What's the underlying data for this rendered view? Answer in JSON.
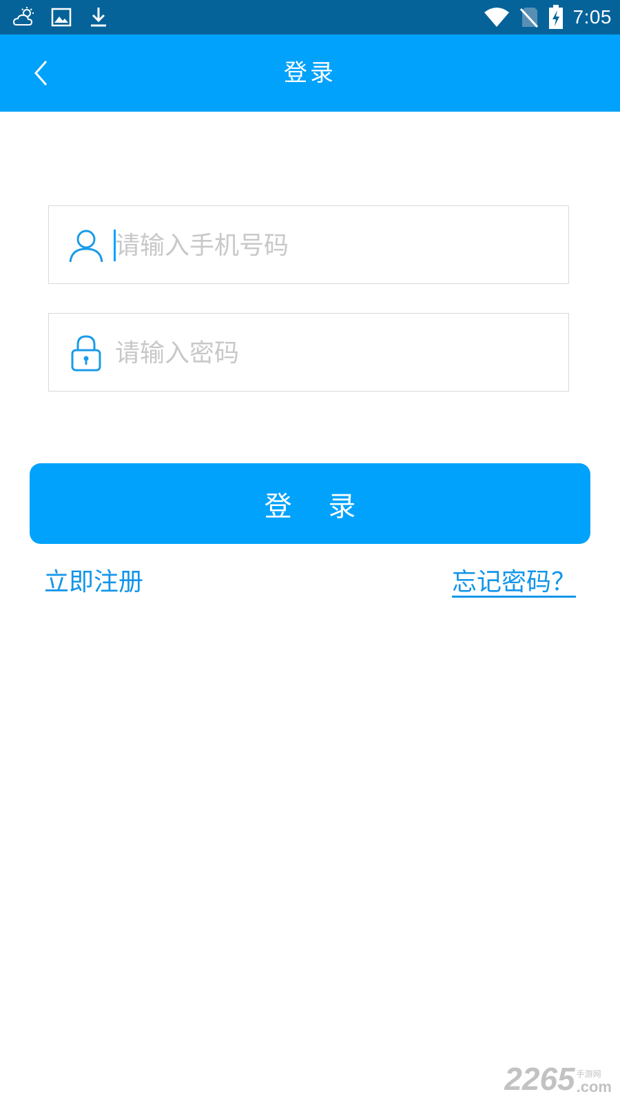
{
  "status_bar": {
    "time": "7:05",
    "left_icons": [
      "weather-icon",
      "image-icon",
      "download-icon"
    ],
    "right_icons": [
      "wifi-icon",
      "no-sim-icon",
      "battery-charging-icon"
    ]
  },
  "app_bar": {
    "title": "登录",
    "back_icon": "chevron-left-icon"
  },
  "form": {
    "phone": {
      "placeholder": "请输入手机号码",
      "value": "",
      "icon": "user-icon"
    },
    "password": {
      "placeholder": "请输入密码",
      "value": "",
      "icon": "lock-icon"
    },
    "login_label": "登 录",
    "register_label": "立即注册",
    "forgot_label": "忘记密码？"
  },
  "watermark": {
    "number": "2265",
    "suffix": ".com",
    "cn": "手游网"
  },
  "colors": {
    "status_bar": "#066399",
    "accent": "#00a2fb",
    "link": "#1295ea",
    "placeholder": "#c8c8c8",
    "border": "#d9d9d9"
  }
}
